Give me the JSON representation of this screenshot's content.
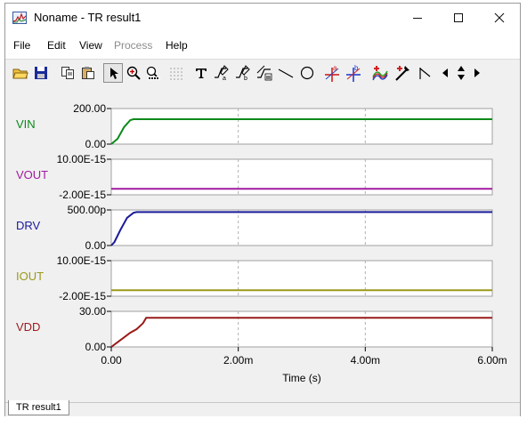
{
  "window": {
    "title": "Noname - TR result1"
  },
  "menu": [
    {
      "label": "File",
      "enabled": true
    },
    {
      "label": "Edit",
      "enabled": true
    },
    {
      "label": "View",
      "enabled": true
    },
    {
      "label": "Process",
      "enabled": false
    },
    {
      "label": "Help",
      "enabled": true
    }
  ],
  "toolbar_icons": [
    "open-folder-icon",
    "save-icon",
    "copy-icon",
    "paste-icon",
    "pointer-icon",
    "zoom-in-icon",
    "zoom-100-icon",
    "grid-icon",
    "text-icon",
    "cursor-a-icon",
    "cursor-b-icon",
    "waveform-icon",
    "line-icon",
    "circle-icon",
    "cursor-a-cross-icon",
    "cursor-b-cross-icon",
    "add-curve-icon",
    "probe-icon",
    "flag-icon",
    "scroll-left-icon",
    "scroll-up-down-icon",
    "scroll-right-icon"
  ],
  "chart_data": {
    "type": "line",
    "xlabel": "Time (s)",
    "x_ticks": [
      "0.00",
      "2.00m",
      "4.00m",
      "6.00m"
    ],
    "xlim": [
      0,
      0.006
    ],
    "x_grid": true,
    "panels": [
      {
        "name": "VIN",
        "color": "#0a8a1a",
        "ticks": [
          "200.00",
          "0.00"
        ],
        "ylim": [
          0,
          200
        ],
        "x": [
          0,
          0.0001,
          0.0002,
          0.0003,
          0.00035,
          0.006
        ],
        "y": [
          0,
          30,
          95,
          135,
          140,
          140
        ]
      },
      {
        "name": "VOUT",
        "color": "#a01aa0",
        "ticks": [
          "10.00E-15",
          "-2.00E-15"
        ],
        "ylim": [
          -2e-15,
          1e-14
        ],
        "x": [
          0,
          0.006
        ],
        "y": [
          0,
          0
        ]
      },
      {
        "name": "DRV",
        "color": "#1a1a9a",
        "ticks": [
          "500.00p",
          "0.00"
        ],
        "ylim": [
          0,
          5e-10
        ],
        "x": [
          0,
          5e-05,
          0.00015,
          0.00025,
          0.00035,
          0.0004,
          0.006
        ],
        "y": [
          0,
          5e-11,
          2.3e-10,
          3.9e-10,
          4.6e-10,
          4.7e-10,
          4.7e-10
        ]
      },
      {
        "name": "IOUT",
        "color": "#9a9a1a",
        "ticks": [
          "10.00E-15",
          "-2.00E-15"
        ],
        "ylim": [
          -2e-15,
          1e-14
        ],
        "x": [
          0,
          0.006
        ],
        "y": [
          0,
          0
        ]
      },
      {
        "name": "VDD",
        "color": "#9a1a1a",
        "ticks": [
          "30.00",
          "0.00"
        ],
        "ylim": [
          0,
          30
        ],
        "x": [
          0,
          0.0001,
          0.0002,
          0.0003,
          0.0004,
          0.0005,
          0.00055,
          0.006
        ],
        "y": [
          0,
          4,
          8,
          12,
          15,
          20,
          24.5,
          24.5
        ]
      }
    ]
  },
  "statusbar": {
    "tab_label": "TR result1"
  }
}
